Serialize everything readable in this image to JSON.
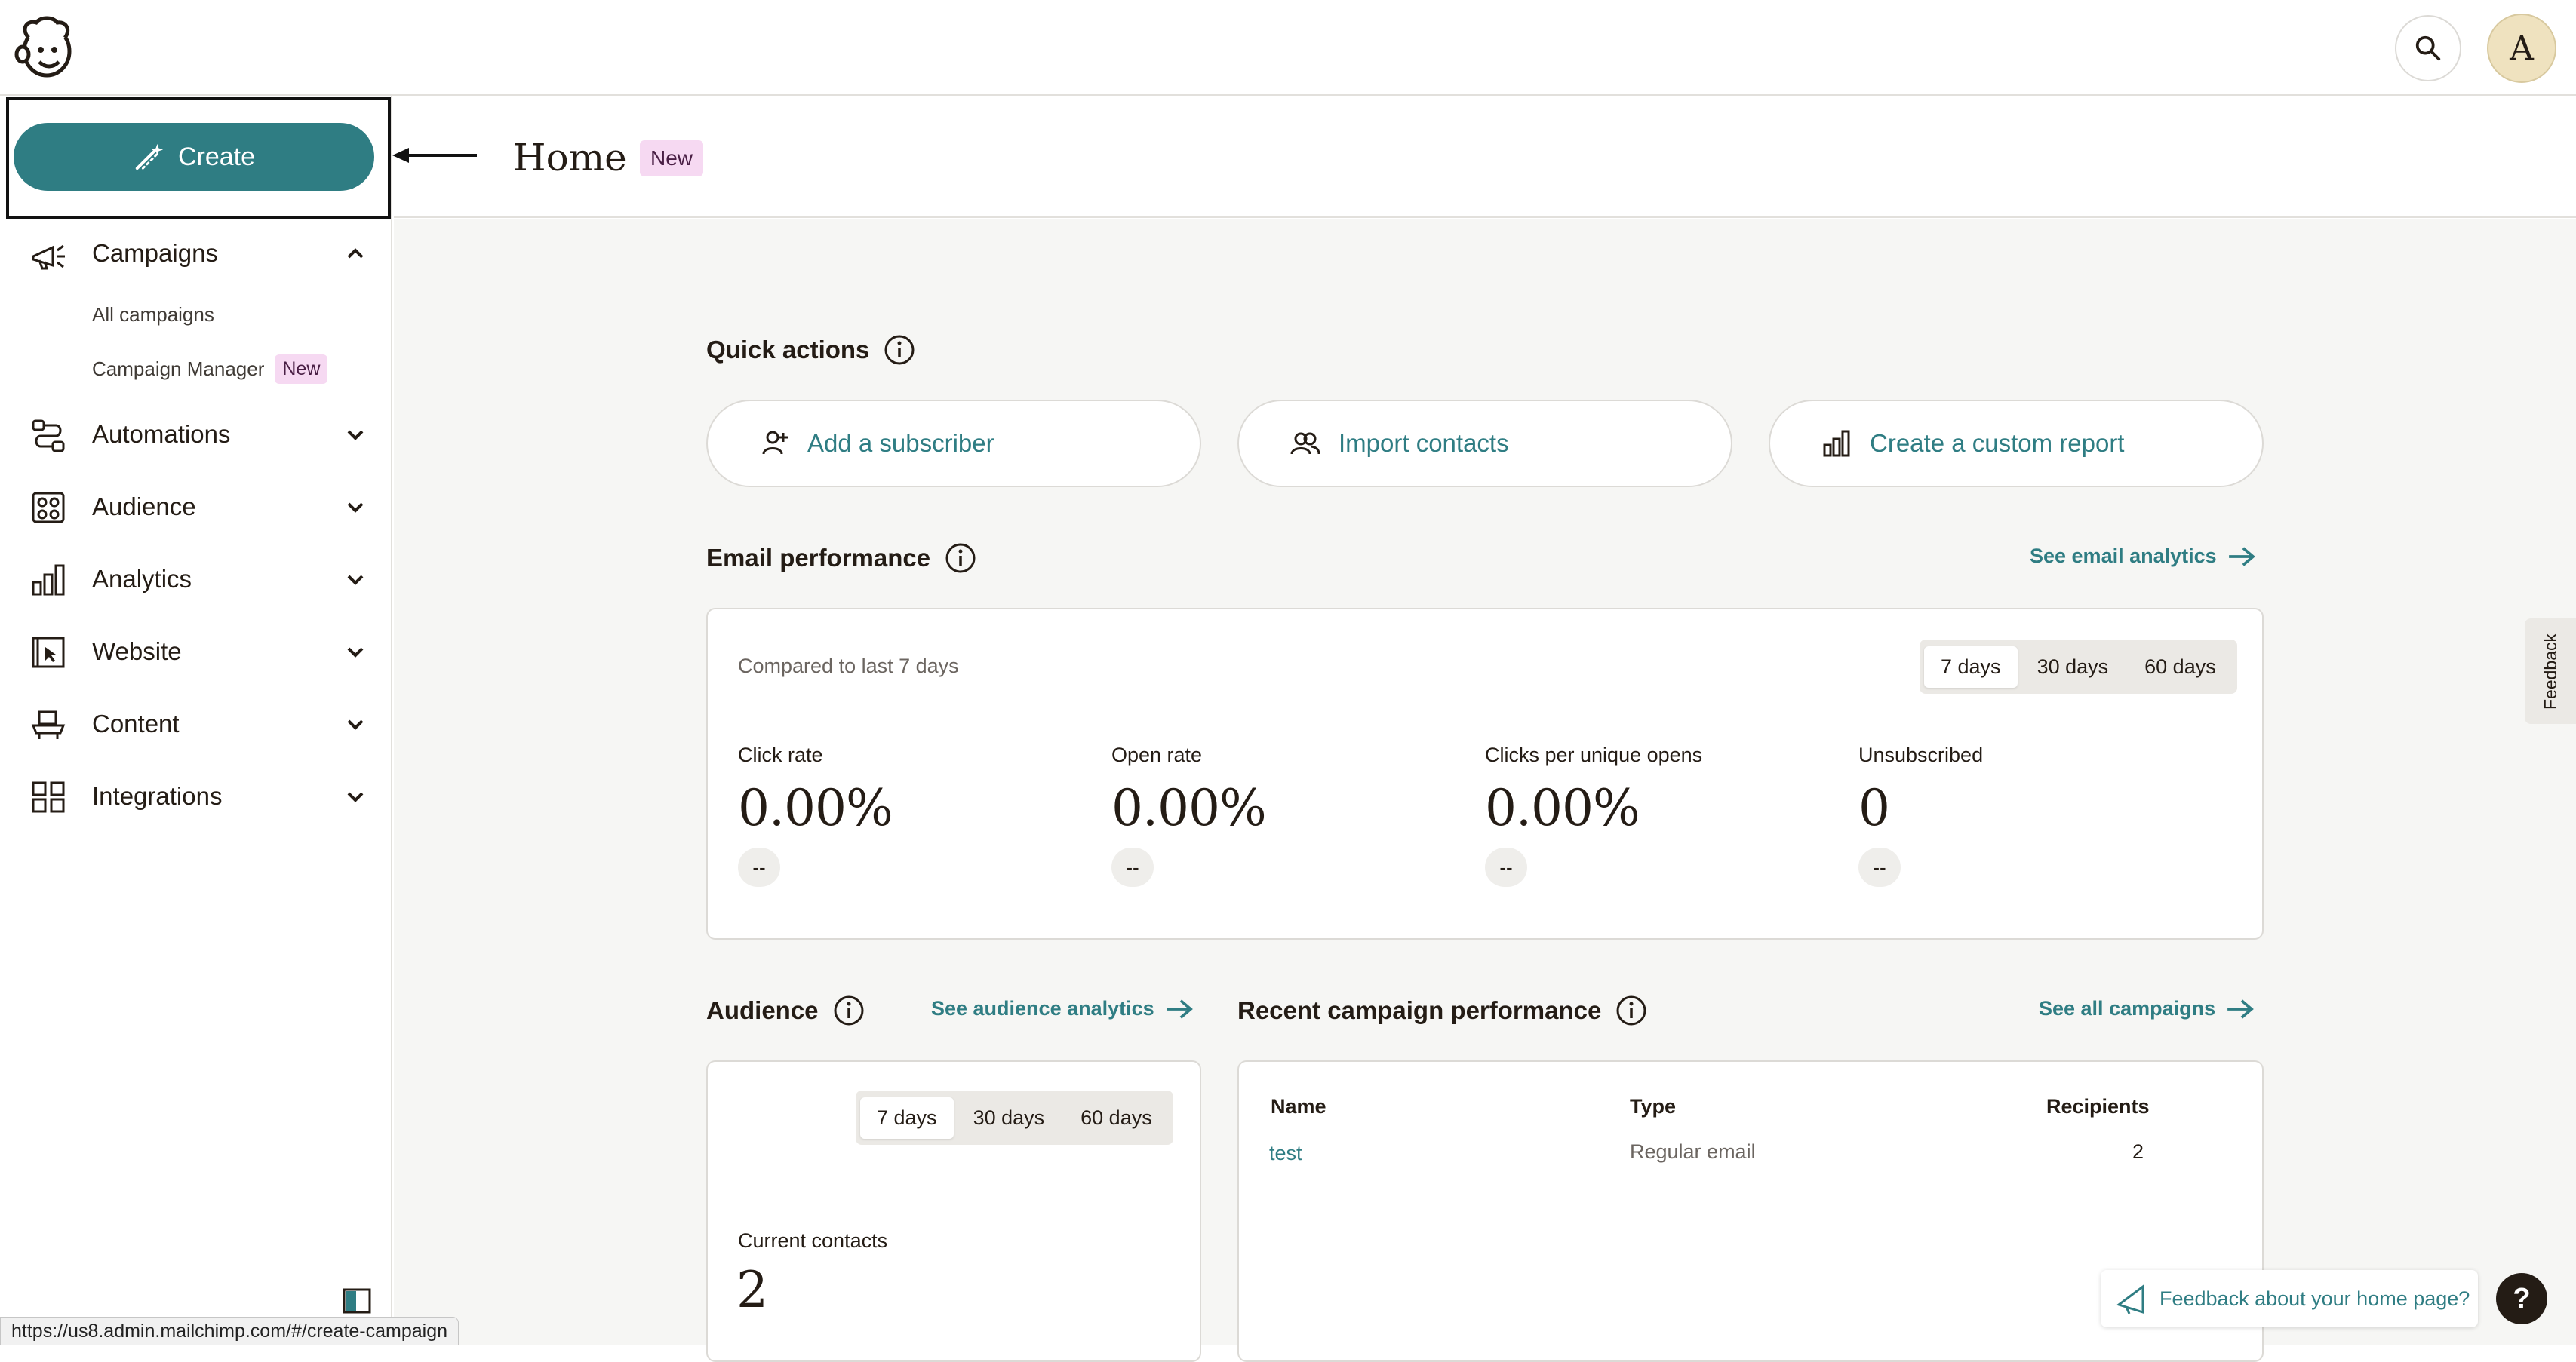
{
  "header": {
    "search_icon": "search-icon",
    "avatar_letter": "A"
  },
  "sidebar": {
    "create_label": "Create",
    "items": [
      {
        "label": "Campaigns",
        "icon": "megaphone-icon",
        "expanded": true
      },
      {
        "label": "Automations",
        "icon": "automation-icon",
        "expanded": false
      },
      {
        "label": "Audience",
        "icon": "audience-icon",
        "expanded": false
      },
      {
        "label": "Analytics",
        "icon": "bar-chart-icon",
        "expanded": false
      },
      {
        "label": "Website",
        "icon": "website-icon",
        "expanded": false
      },
      {
        "label": "Content",
        "icon": "content-icon",
        "expanded": false
      },
      {
        "label": "Integrations",
        "icon": "grid-icon",
        "expanded": false
      }
    ],
    "sub_items": [
      {
        "label": "All campaigns"
      },
      {
        "label": "Campaign Manager",
        "badge": "New"
      }
    ]
  },
  "page": {
    "title": "Home",
    "badge": "New"
  },
  "quick_actions": {
    "title": "Quick actions",
    "buttons": [
      {
        "label": "Add a subscriber"
      },
      {
        "label": "Import contacts"
      },
      {
        "label": "Create a custom report"
      }
    ]
  },
  "email_performance": {
    "title": "Email performance",
    "link": "See email analytics",
    "compared_text": "Compared to last 7 days",
    "ranges": [
      "7 days",
      "30 days",
      "60 days"
    ],
    "selected_range": "7 days",
    "metrics": [
      {
        "label": "Click rate",
        "value": "0.00%",
        "delta": "--"
      },
      {
        "label": "Open rate",
        "value": "0.00%",
        "delta": "--"
      },
      {
        "label": "Clicks per unique opens",
        "value": "0.00%",
        "delta": "--"
      },
      {
        "label": "Unsubscribed",
        "value": "0",
        "delta": "--"
      }
    ]
  },
  "audience": {
    "title": "Audience",
    "link": "See audience analytics",
    "ranges": [
      "7 days",
      "30 days",
      "60 days"
    ],
    "selected_range": "7 days",
    "current_contacts_label": "Current contacts",
    "current_contacts_value": "2"
  },
  "recent_campaigns": {
    "title": "Recent campaign performance",
    "link": "See all campaigns",
    "columns": [
      "Name",
      "Type",
      "Recipients"
    ],
    "rows": [
      {
        "name": "test",
        "type": "Regular email",
        "recipients": "2"
      }
    ]
  },
  "feedback": {
    "tab_label": "Feedback",
    "home_label": "Feedback about your home page?",
    "help_label": "?"
  },
  "status_bar": {
    "url": "https://us8.admin.mailchimp.com/#/create-campaign"
  },
  "colors": {
    "accent": "#2f7d83",
    "badge_bg": "#f6d9f2",
    "main_bg": "#f6f6f4"
  }
}
